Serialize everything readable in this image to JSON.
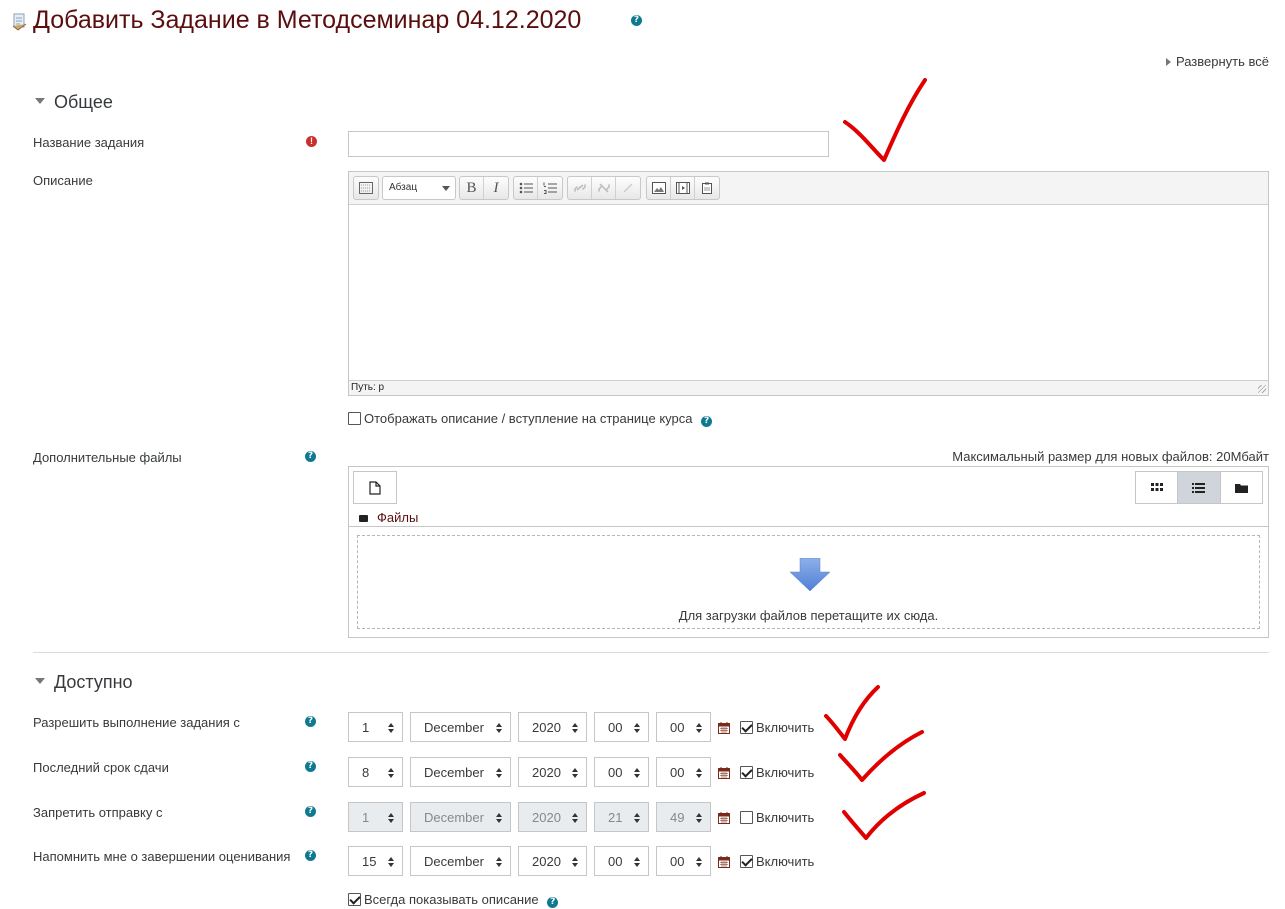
{
  "page": {
    "title": "Добавить Задание в Методсеминар 04.12.2020",
    "expand_all": "Развернуть всё"
  },
  "general": {
    "heading": "Общее",
    "name_label": "Название задания",
    "name_value": "",
    "description_label": "Описание",
    "editor": {
      "format_select": "Абзац",
      "bold": "B",
      "italic": "I",
      "path": "Путь: p"
    },
    "show_description_label": "Отображать описание / вступление на странице курса",
    "additional_files_label": "Дополнительные файлы",
    "max_file_size": "Максимальный размер для новых файлов: 20Мбайт",
    "files_folder": "Файлы",
    "drop_hint": "Для загрузки файлов перетащите их сюда."
  },
  "availability": {
    "heading": "Доступно",
    "enable_label": "Включить",
    "rows": [
      {
        "label": "Разрешить выполнение задания с",
        "day": "1",
        "month": "December",
        "year": "2020",
        "hour": "00",
        "minute": "00",
        "enabled": true
      },
      {
        "label": "Последний срок сдачи",
        "day": "8",
        "month": "December",
        "year": "2020",
        "hour": "00",
        "minute": "00",
        "enabled": true
      },
      {
        "label": "Запретить отправку с",
        "day": "1",
        "month": "December",
        "year": "2020",
        "hour": "21",
        "minute": "49",
        "enabled": false
      },
      {
        "label": "Напомнить мне о завершении оценивания",
        "day": "15",
        "month": "December",
        "year": "2020",
        "hour": "00",
        "minute": "00",
        "enabled": true
      }
    ],
    "always_show_label": "Всегда показывать описание"
  },
  "colors": {
    "title": "#5a0e0e",
    "help_icon": "#0f7a8f",
    "required_icon": "#c9302c",
    "annotation_marks": "#e00000"
  }
}
